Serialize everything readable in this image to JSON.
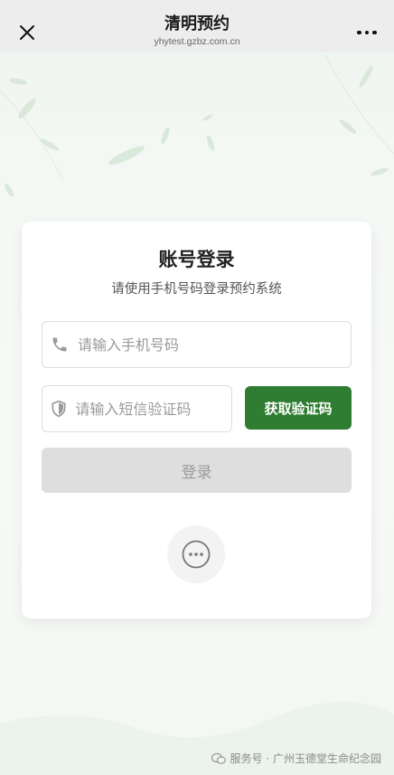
{
  "topbar": {
    "title": "清明预约",
    "domain": "yhytest.gzbz.com.cn",
    "close_icon": "close-icon",
    "more_icon": "more-dots-icon"
  },
  "login": {
    "title": "账号登录",
    "subtitle": "请使用手机号码登录预约系统",
    "phone_placeholder": "请输入手机号码",
    "code_placeholder": "请输入短信验证码",
    "get_code_label": "获取验证码",
    "login_label": "登录",
    "more_icon": "more-options-icon"
  },
  "footer": {
    "text": "服务号 · 广州玉德堂生命纪念园",
    "icon": "wechat-service-icon"
  },
  "colors": {
    "accent": "#2e7d32",
    "disabled_button": "#dedede",
    "topbar": "#ededed"
  }
}
